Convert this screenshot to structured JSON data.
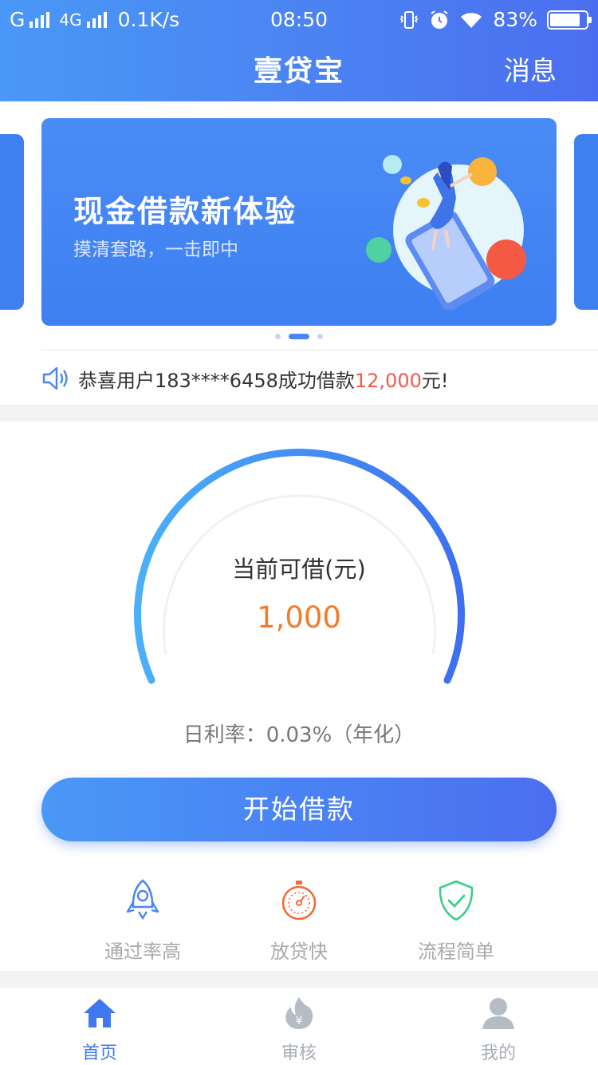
{
  "status_bar": {
    "carrier_left": "G",
    "network": "4G",
    "speed": "0.1K/s",
    "time": "08:50",
    "battery": "83%",
    "battery_level": 0.83
  },
  "nav": {
    "title": "壹贷宝",
    "message_label": "消息"
  },
  "banner": {
    "title": "现金借款新体验",
    "subtitle": "摸清套路，一击即中",
    "slide_count": 3,
    "active_slide": 1
  },
  "notice": {
    "prefix": "恭喜用户183****6458成功借款",
    "amount": "12,000",
    "suffix": "元!"
  },
  "loan": {
    "label": "当前可借(元)",
    "amount": "1,000",
    "rate_text": "日利率：0.03%（年化）",
    "button_label": "开始借款"
  },
  "features": [
    {
      "label": "通过率高",
      "icon": "rocket-icon"
    },
    {
      "label": "放贷快",
      "icon": "stopwatch-icon"
    },
    {
      "label": "流程简单",
      "icon": "shield-check-icon"
    }
  ],
  "tabs": [
    {
      "label": "首页",
      "icon": "home-icon",
      "active": true
    },
    {
      "label": "审核",
      "icon": "flame-yen-icon",
      "active": false
    },
    {
      "label": "我的",
      "icon": "user-icon",
      "active": false
    }
  ],
  "colors": {
    "primary": "#4b82f2",
    "accent_orange": "#f47b2a",
    "accent_red": "#f15b4c",
    "feature_green": "#3ccf89"
  }
}
